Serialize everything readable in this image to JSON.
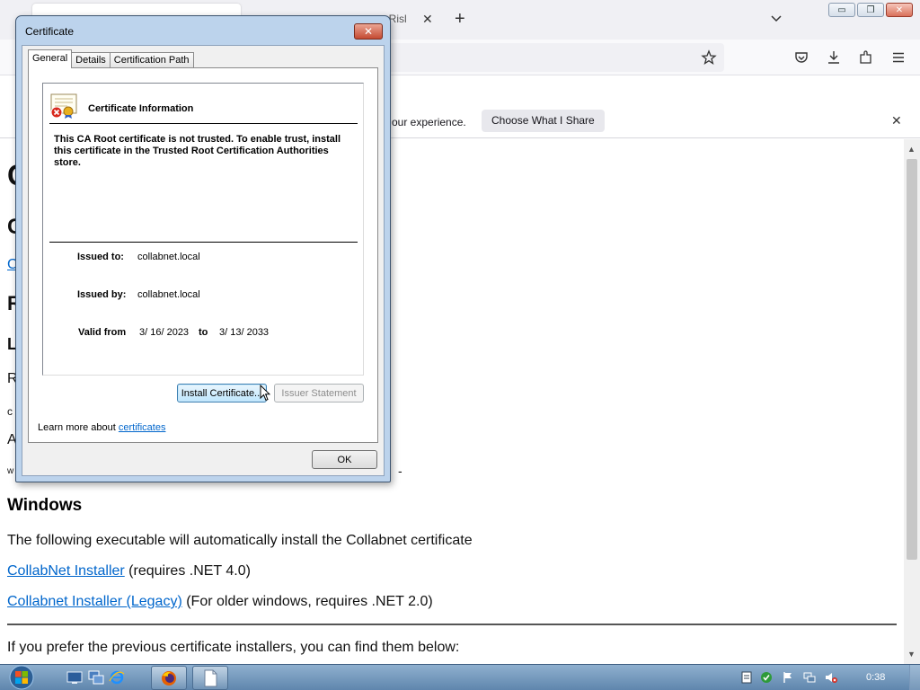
{
  "browser": {
    "tab_partial_text": "ty Risl",
    "tab_close_glyph": "✕",
    "new_tab_glyph": "+",
    "notification": {
      "text": "our experience.",
      "button": "Choose What I Share",
      "close_glyph": "✕"
    }
  },
  "window_buttons": {
    "minimize": "▭",
    "restore": "❐",
    "close": "✕"
  },
  "page": {
    "fragments": [
      {
        "text": "C",
        "style": "h1"
      },
      {
        "text": "C",
        "style": "h2"
      },
      {
        "text": "C",
        "style": "link"
      },
      {
        "text": "R",
        "style": "h2"
      },
      {
        "text": "L",
        "style": "h3"
      },
      {
        "text": "R",
        "style": "text"
      },
      {
        "text": "c",
        "style": "small"
      },
      {
        "text": "A",
        "style": "text"
      },
      {
        "text": "w",
        "style": "tiny"
      }
    ],
    "dash": "-",
    "windows_heading": "Windows",
    "intro": "The following executable will automatically install the Collabnet certificate",
    "installer_link": "CollabNet Installer",
    "installer_note": " (requires .NET 4.0)",
    "legacy_link": "Collabnet Installer (Legacy)",
    "legacy_note": " (For older windows, requires .NET 2.0)",
    "previous_text": "If you prefer the previous certificate installers, you can find them below:"
  },
  "dialog": {
    "title": "Certificate",
    "close_glyph": "✕",
    "tabs": [
      "General",
      "Details",
      "Certification Path"
    ],
    "info_title": "Certificate Information",
    "warning": "This CA Root certificate is not trusted. To enable trust, install this certificate in the Trusted Root Certification Authorities store.",
    "issued_to_label": "Issued to:",
    "issued_to": "collabnet.local",
    "issued_by_label": "Issued by:",
    "issued_by": "collabnet.local",
    "valid_from_label": "Valid from",
    "valid_from": "3/ 16/ 2023",
    "to_label": "to",
    "valid_to": "3/ 13/ 2033",
    "install_button": "Install Certificate...",
    "issuer_button": "Issuer Statement",
    "learn_text": "Learn more about ",
    "learn_link": "certificates",
    "ok_button": "OK"
  },
  "taskbar": {
    "clock": "0:38"
  },
  "colors": {
    "link": "#0066cc",
    "dialog_frame": "#bcd3ec",
    "taskbar": "#6f93b8"
  }
}
